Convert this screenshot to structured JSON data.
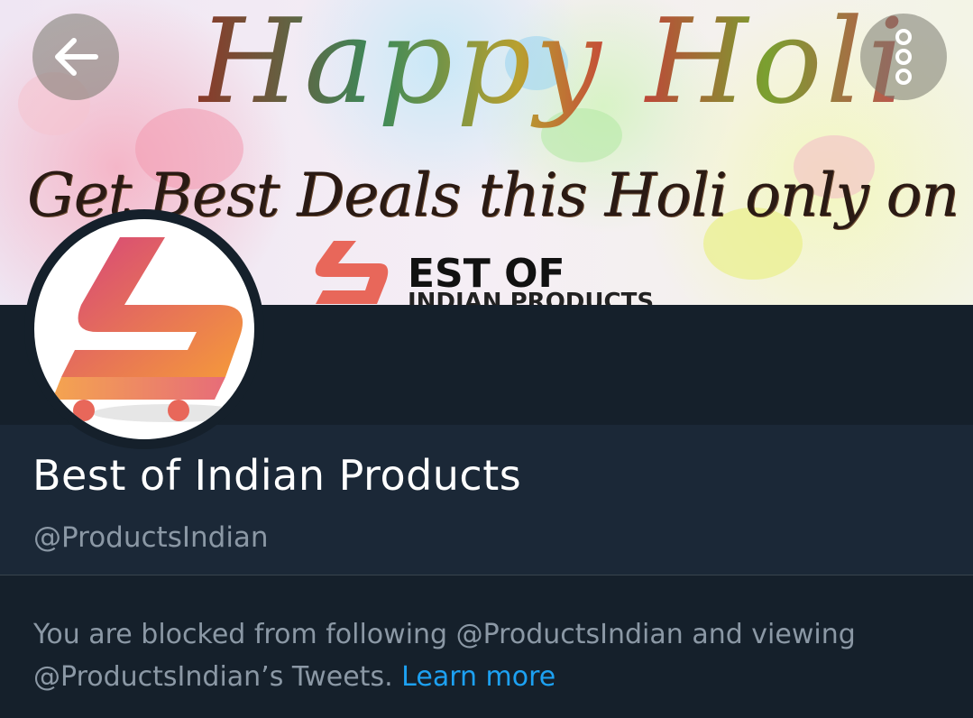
{
  "banner": {
    "title": "Happy Holi",
    "subtitle": "Get Best Deals this Holi only on",
    "brand_line1": "EST OF",
    "brand_line2": "INDIAN PRODUCTS"
  },
  "toolbar": {
    "back_icon": "arrow-left-icon",
    "more_icon": "more-vertical-icon"
  },
  "profile": {
    "name": "Best of Indian Products",
    "handle": "@ProductsIndian",
    "blocked_text": "You are blocked from following @ProductsIndian and viewing @ProductsIndian’s Tweets.",
    "learn_more": "Learn more"
  },
  "colors": {
    "background": "#15202b",
    "info_panel": "#1b2837",
    "secondary_text": "#8b98a5",
    "link": "#1da1f2"
  }
}
